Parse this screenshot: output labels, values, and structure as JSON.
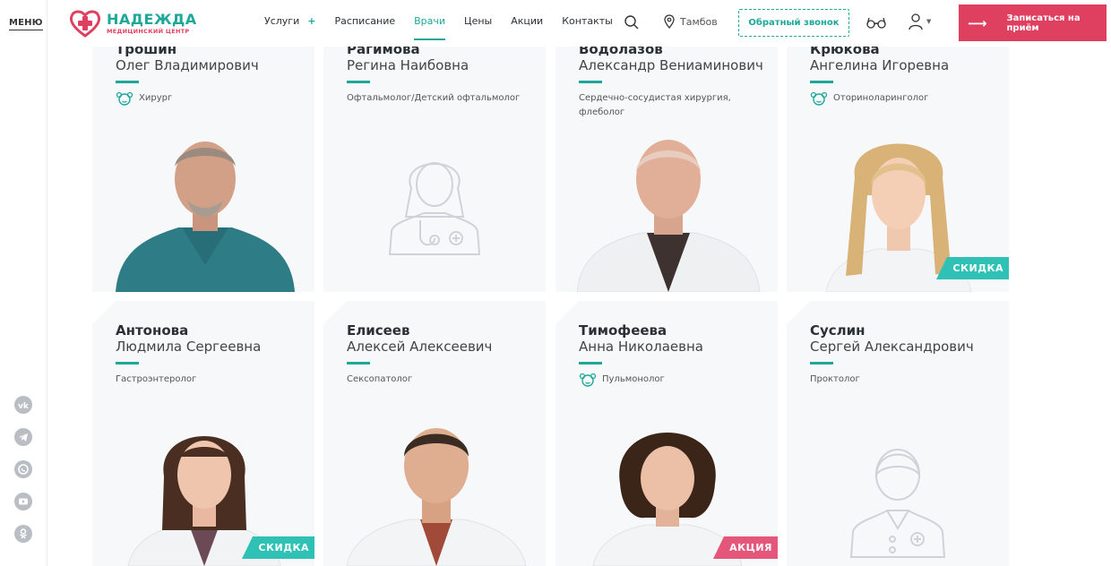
{
  "left_rail": {
    "menu_label": "МЕНЮ",
    "socials": [
      "vk-icon",
      "telegram-icon",
      "whatsapp-icon",
      "youtube-icon",
      "odnoklassniki-icon"
    ]
  },
  "header": {
    "logo": {
      "title": "НАДЕЖДА",
      "subtitle": "МЕДИЦИНСКИЙ ЦЕНТР"
    },
    "nav": [
      {
        "label": "Услуги",
        "has_plus": true,
        "plus": "+"
      },
      {
        "label": "Расписание"
      },
      {
        "label": "Врачи",
        "active": true
      },
      {
        "label": "Цены"
      },
      {
        "label": "Акции"
      },
      {
        "label": "Контакты"
      }
    ],
    "city": "Тамбов",
    "callback_label": "Обратный звонок",
    "book_label": "Записаться на приём",
    "colors": {
      "accent": "#1fa89a",
      "brand": "#e0405f"
    }
  },
  "doctors": [
    {
      "surname": "Трошин",
      "given": "Олег Владимирович",
      "specialty": "Хирург",
      "kids_icon": true,
      "photo": "photo-man-scrubs",
      "badge": null
    },
    {
      "surname": "Рагимова",
      "given": "Регина Наибовна",
      "specialty": "Офтальмолог/Детский офтальмолог",
      "kids_icon": false,
      "photo": "placeholder-female",
      "badge": null
    },
    {
      "surname": "Водолазов",
      "given": "Александр Вениаминович",
      "specialty": "Сердечно-сосудистая хирургия, флеболог",
      "kids_icon": false,
      "photo": "photo-man-coat",
      "badge": null
    },
    {
      "surname": "Крюкова",
      "given": "Ангелина Игоревна",
      "specialty": "Оториноларинголог",
      "kids_icon": true,
      "photo": "photo-woman-blonde",
      "badge": "СКИДКА"
    },
    {
      "surname": "Антонова",
      "given": "Людмила Сергеевна",
      "specialty": "Гастроэнтеролог",
      "kids_icon": false,
      "photo": "photo-woman-bangs",
      "badge": "СКИДКА"
    },
    {
      "surname": "Елисеев",
      "given": "Алексей Алексеевич",
      "specialty": "Сексопатолог",
      "kids_icon": false,
      "photo": "photo-man-short",
      "badge": null
    },
    {
      "surname": "Тимофеева",
      "given": "Анна Николаевна",
      "specialty": "Пульмонолог",
      "kids_icon": true,
      "photo": "photo-woman-dark",
      "badge": "АКЦИЯ"
    },
    {
      "surname": "Суслин",
      "given": "Сергей Александрович",
      "specialty": "Проктолог",
      "kids_icon": false,
      "photo": "placeholder-male",
      "badge": null
    }
  ]
}
